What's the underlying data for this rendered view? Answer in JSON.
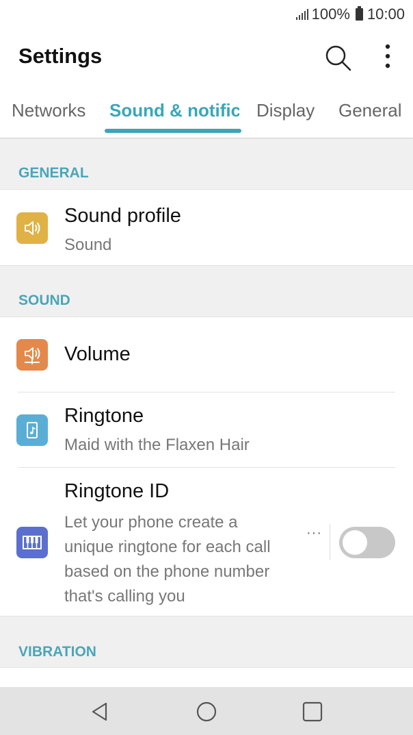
{
  "status_bar": {
    "battery_percent": "100%",
    "time": "10:00"
  },
  "app_bar": {
    "title": "Settings",
    "search_icon": "search-icon",
    "more_icon": "more-vert-icon"
  },
  "tabs": [
    {
      "label": "Networks",
      "active": false
    },
    {
      "label": "Sound & notifications",
      "active": true
    },
    {
      "label": "Display",
      "active": false
    },
    {
      "label": "General",
      "active": false
    }
  ],
  "colors": {
    "accent": "#3aa6b9",
    "sound_profile_icon": "#e0b246",
    "volume_icon": "#e5894a",
    "ringtone_icon": "#5aaed6",
    "ringtone_id_icon": "#5b6fcf"
  },
  "sections": {
    "general": {
      "header": "GENERAL",
      "items": [
        {
          "title": "Sound profile",
          "subtitle": "Sound",
          "icon": "speaker-icon"
        }
      ]
    },
    "sound": {
      "header": "SOUND",
      "items": [
        {
          "title": "Volume",
          "icon": "volume-icon"
        },
        {
          "title": "Ringtone",
          "subtitle": "Maid with the Flaxen Hair",
          "icon": "music-file-icon"
        },
        {
          "title": "Ringtone ID",
          "subtitle": "Let your phone create a unique ringtone for each call based on the phone number that's calling you",
          "icon": "piano-icon",
          "toggle_on": false
        }
      ]
    },
    "vibration": {
      "header": "VIBRATION"
    }
  },
  "nav_bar": {
    "back_icon": "back-icon",
    "home_icon": "home-icon",
    "recents_icon": "recents-icon"
  }
}
